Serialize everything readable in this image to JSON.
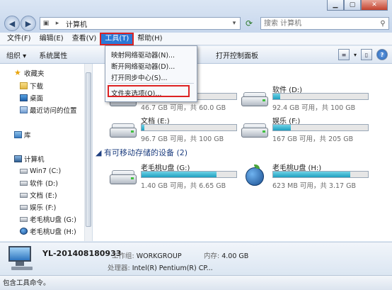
{
  "address": {
    "path": "计算机"
  },
  "search": {
    "placeholder": "搜索 计算机"
  },
  "menubar": [
    "文件(F)",
    "编辑(E)",
    "查看(V)",
    "工具(T)",
    "帮助(H)"
  ],
  "toolbar": {
    "organize": "组织",
    "system_properties": "系统属性",
    "control_panel": "打开控制面板"
  },
  "tools_menu": {
    "items": [
      "映射网络驱动器(N)...",
      "断开网络驱动器(D)...",
      "打开同步中心(S)...",
      "文件夹选项(O)..."
    ]
  },
  "nav": {
    "favorites": "收藏夹",
    "downloads": "下载",
    "desktop": "桌面",
    "recent": "最近访问的位置",
    "libraries": "库",
    "computer": "计算机",
    "drives": [
      "Win7 (C:)",
      "软件 (D:)",
      "文档 (E:)",
      "娱乐 (F:)",
      "老毛桃U盘 (G:)",
      "老毛桃U盘 (H:)"
    ]
  },
  "content": {
    "removable_header": "有可移动存储的设备 (2)",
    "hard_drives": [
      {
        "name": "",
        "info": "46.7 GB 可用，共 60.0 GB",
        "used_fraction": 0.22
      },
      {
        "name": "软件 (D:)",
        "info": "92.4 GB 可用，共 100 GB",
        "used_fraction": 0.076
      },
      {
        "name": "文档 (E:)",
        "info": "96.7 GB 可用，共 100 GB",
        "used_fraction": 0.033
      },
      {
        "name": "娱乐 (F:)",
        "info": "167 GB 可用，共 205 GB",
        "used_fraction": 0.185
      }
    ],
    "removable_drives": [
      {
        "name": "老毛桃U盘 (G:)",
        "info": "1.40 GB 可用，共 6.65 GB",
        "used_fraction": 0.79
      },
      {
        "name": "老毛桃U盘 (H:)",
        "info": "623 MB 可用，共 3.17 GB",
        "used_fraction": 0.81
      }
    ]
  },
  "details": {
    "computer_name": "YL-201408180933",
    "workgroup_label": "工作组:",
    "workgroup": "WORKGROUP",
    "memory_label": "内存:",
    "memory": "4.00 GB",
    "processor_label": "处理器:",
    "processor": "Intel(R) Pentium(R) CP..."
  },
  "statusbar": {
    "text": "包含工具命令。"
  },
  "colors": {
    "accent": "#2b78d6",
    "highlight_box": "#dd2222",
    "drive_bar": "#1f9fc0"
  }
}
